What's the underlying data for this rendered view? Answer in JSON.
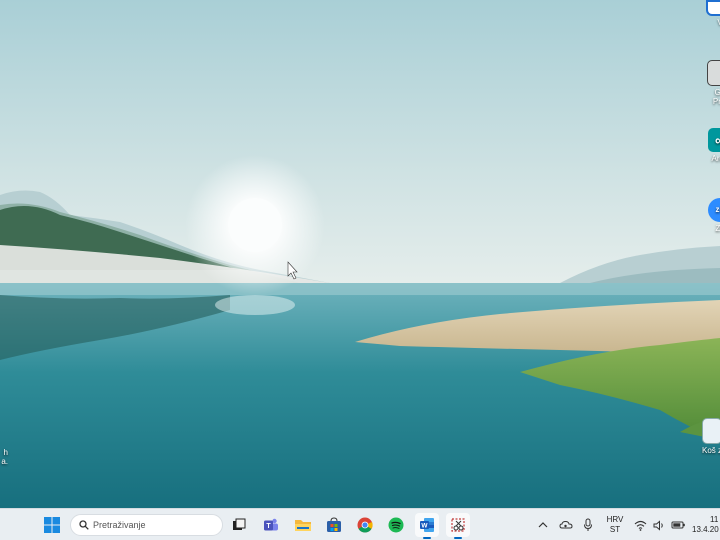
{
  "desktop": {
    "icons": [
      {
        "label": "V"
      },
      {
        "label": "Go"
      },
      {
        "label": "Prin"
      },
      {
        "label": "Ardu"
      },
      {
        "label": "Zo"
      },
      {
        "label": "Koš z"
      },
      {
        "label": "h"
      },
      {
        "label": "a."
      }
    ]
  },
  "taskbar": {
    "search_placeholder": "Pretraživanje",
    "language": "HRV",
    "layout": "ST",
    "clock_time": "11",
    "clock_date": "13.4.20"
  },
  "colors": {
    "taskbar_bg": "#e9eef2",
    "accent": "#0067c0"
  }
}
